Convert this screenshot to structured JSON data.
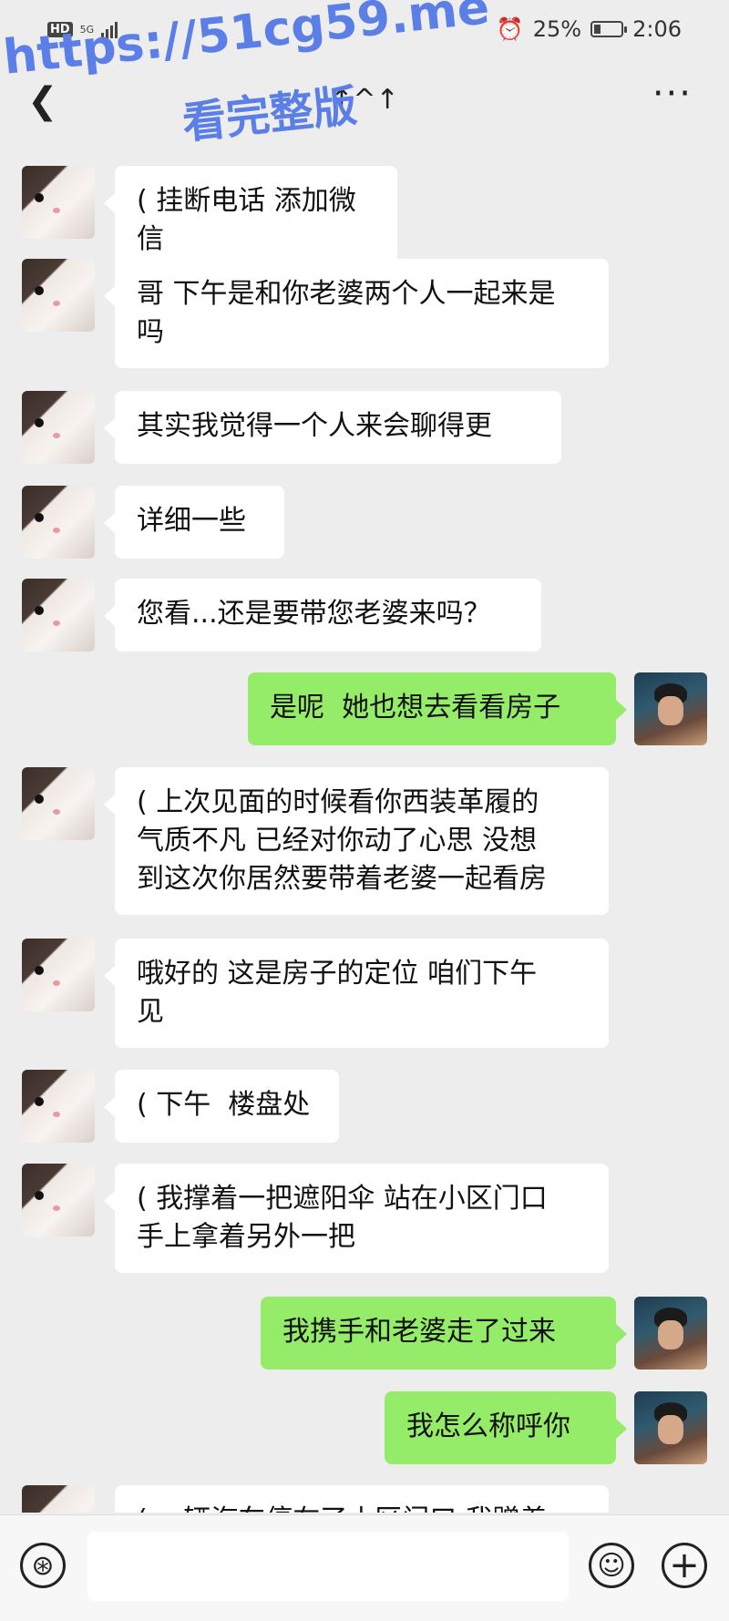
{
  "status_bar": {
    "hd": "HD",
    "network": "5G",
    "battery_percent": "25%",
    "battery_level": 0.25,
    "time": "2:06"
  },
  "title_bar": {
    "back_icon": "chevron-left-icon",
    "title": "↑^↑",
    "more": "···"
  },
  "watermark": {
    "line1": "https://51cg59.me",
    "line2": "看完整版"
  },
  "messages": [
    {
      "side": "in",
      "text": "( 挂断电话 添加微信"
    },
    {
      "side": "in",
      "text": "哥 下午是和你老婆两个人一起来是\n吗"
    },
    {
      "side": "in",
      "text": "其实我觉得一个人来会聊得更"
    },
    {
      "side": "in",
      "text": "详细一些"
    },
    {
      "side": "in",
      "text": "您看...还是要带您老婆来吗？"
    },
    {
      "side": "out",
      "text": "是呢  她也想去看看房子"
    },
    {
      "side": "in",
      "text": "( 上次见面的时候看你西装革履的\n气质不凡 已经对你动了心思 没想\n到这次你居然要带着老婆一起看房"
    },
    {
      "side": "in",
      "text": "哦好的 这是房子的定位 咱们下午\n见"
    },
    {
      "side": "in",
      "text": "( 下午  楼盘处"
    },
    {
      "side": "in",
      "text": "( 我撑着一把遮阳伞 站在小区门口\n手上拿着另外一把"
    },
    {
      "side": "out",
      "text": "我携手和老婆走了过来"
    },
    {
      "side": "out",
      "text": "我怎么称呼你"
    },
    {
      "side": "in",
      "text": "( 一辆汽车停在了小区门口 我蹭着"
    }
  ],
  "input_bar": {
    "voice_icon": "voice-icon",
    "emoji_icon": "emoji-icon",
    "plus_icon": "plus-icon"
  }
}
